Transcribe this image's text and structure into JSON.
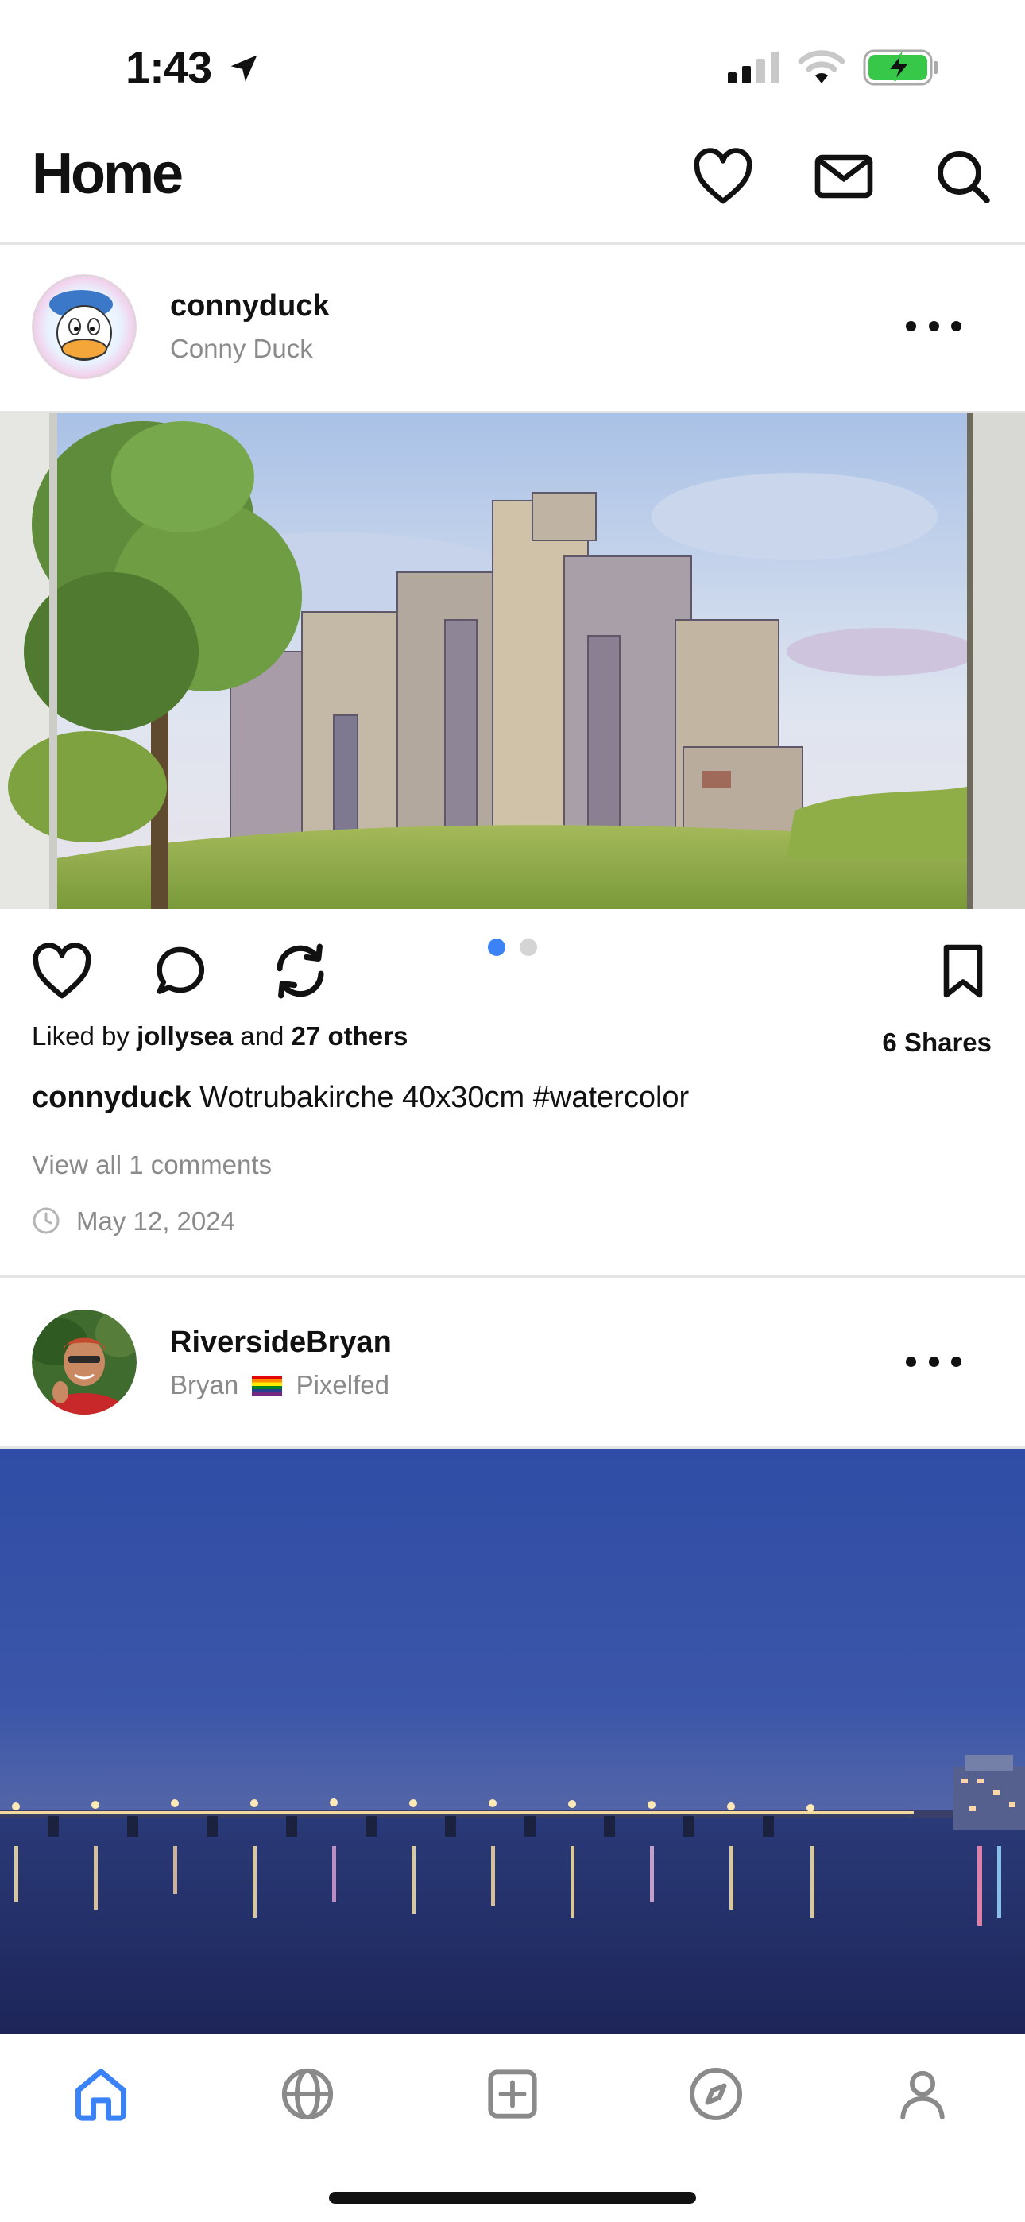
{
  "status_bar": {
    "time": "1:43"
  },
  "header": {
    "title": "Home"
  },
  "posts": [
    {
      "username": "connyduck",
      "display_name": "Conny Duck",
      "liked_by_prefix": "Liked by",
      "liked_by_user": "jollysea",
      "liked_by_and": "and",
      "liked_by_others": "27 others",
      "shares": "6 Shares",
      "caption_user": "connyduck",
      "caption_text": "Wotrubakirche 40x30cm #watercolor",
      "comments_link": "View all 1 comments",
      "date": "May 12, 2024",
      "carousel": {
        "count": 2,
        "active_index": 0
      }
    },
    {
      "username": "RiversideBryan",
      "display_name_prefix": "Bryan",
      "display_name_emoji": "🏳️‍🌈",
      "display_name_suffix": "Pixelfed"
    }
  ],
  "colors": {
    "accent": "#3b82f6",
    "inactive_dot": "#d4d4d4",
    "muted_text": "#8a8a8a"
  },
  "icons": {
    "header": [
      "heart-icon",
      "mail-icon",
      "search-icon"
    ],
    "actions": [
      "heart-icon",
      "comment-icon",
      "repost-icon",
      "bookmark-icon"
    ],
    "tabs": [
      "home-icon",
      "globe-icon",
      "plus-square-icon",
      "compass-icon",
      "person-icon"
    ]
  }
}
